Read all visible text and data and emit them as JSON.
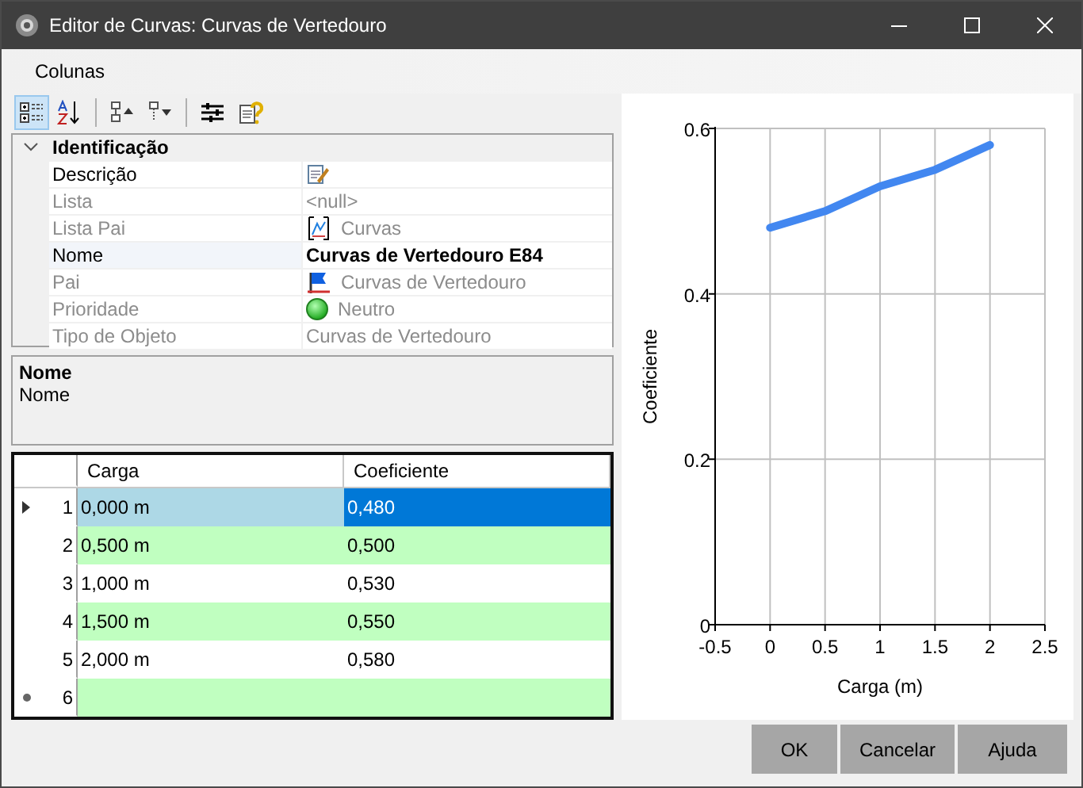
{
  "window": {
    "title": "Editor de Curvas: Curvas de Vertedouro"
  },
  "menu": [
    "Colunas"
  ],
  "toolbar": [
    {
      "kind": "categorized",
      "selected": true
    },
    {
      "kind": "alphabetical",
      "selected": false
    },
    {
      "kind": "expand"
    },
    {
      "kind": "collapse"
    },
    {
      "kind": "pages"
    },
    {
      "kind": "help"
    }
  ],
  "properties": {
    "category": "Identificação",
    "expanded": true,
    "rows": [
      {
        "label": "Descrição",
        "kind": "edit",
        "disabled": false,
        "selected": false
      },
      {
        "label": "Lista",
        "value": "<null>",
        "kind": "plain",
        "disabled": true,
        "selected": false,
        "modified": false
      },
      {
        "label": "Lista Pai",
        "value": "Curvas",
        "kind": "chart",
        "disabled": true,
        "selected": false,
        "modified": false
      },
      {
        "label": "Nome",
        "value": "Curvas de Vertedouro E84",
        "kind": "plain",
        "disabled": false,
        "selected": true,
        "modified": true
      },
      {
        "label": "Pai",
        "value": "Curvas de Vertedouro",
        "kind": "flag",
        "disabled": true,
        "selected": false,
        "modified": false
      },
      {
        "label": "Prioridade",
        "value": "Neutro",
        "kind": "status",
        "disabled": true,
        "selected": false,
        "modified": false
      },
      {
        "label": "Tipo de Objeto",
        "value": "Curvas de Vertedouro",
        "kind": "plain",
        "disabled": true,
        "selected": false,
        "modified": false
      }
    ]
  },
  "description": {
    "title": "Nome",
    "text": "Nome"
  },
  "table": {
    "columns": [
      "Carga",
      "Coeficiente"
    ],
    "rows": [
      {
        "header": "1",
        "kind": "current",
        "selected": true,
        "cells": [
          {
            "text": "0,000 m",
            "focused": false
          },
          {
            "text": "0,480",
            "focused": true
          }
        ]
      },
      {
        "header": "2",
        "kind": "normal",
        "selected": false,
        "cells": [
          {
            "text": "0,500 m",
            "focused": false
          },
          {
            "text": "0,500",
            "focused": false
          }
        ]
      },
      {
        "header": "3",
        "kind": "normal",
        "selected": false,
        "cells": [
          {
            "text": "1,000 m",
            "focused": false
          },
          {
            "text": "0,530",
            "focused": false
          }
        ]
      },
      {
        "header": "4",
        "kind": "normal",
        "selected": false,
        "cells": [
          {
            "text": "1,500 m",
            "focused": false
          },
          {
            "text": "0,550",
            "focused": false
          }
        ]
      },
      {
        "header": "5",
        "kind": "normal",
        "selected": false,
        "cells": [
          {
            "text": "2,000 m",
            "focused": false
          },
          {
            "text": "0,580",
            "focused": false
          }
        ]
      },
      {
        "header": "6",
        "kind": "new",
        "selected": false
      }
    ]
  },
  "chart": {
    "chart_data": {
      "type": "line",
      "xlabel": "Carga (m)",
      "ylabel": "Coeficiente",
      "x": [
        0,
        0.5,
        1,
        1.5,
        2
      ],
      "grid": true,
      "series": [
        {
          "color": "#4287f0",
          "values": [
            0.48,
            0.5,
            0.53,
            0.55,
            0.58
          ]
        }
      ],
      "xlim": [
        -0.5,
        2.5
      ],
      "ylim": [
        0,
        0.6
      ],
      "xticks": [
        -0.5,
        0,
        0.5,
        1,
        1.5,
        2,
        2.5
      ],
      "yticks": [
        0,
        0.2,
        0.4,
        0.6
      ]
    }
  },
  "buttons": [
    "OK",
    "Cancelar",
    "Ajuda"
  ]
}
